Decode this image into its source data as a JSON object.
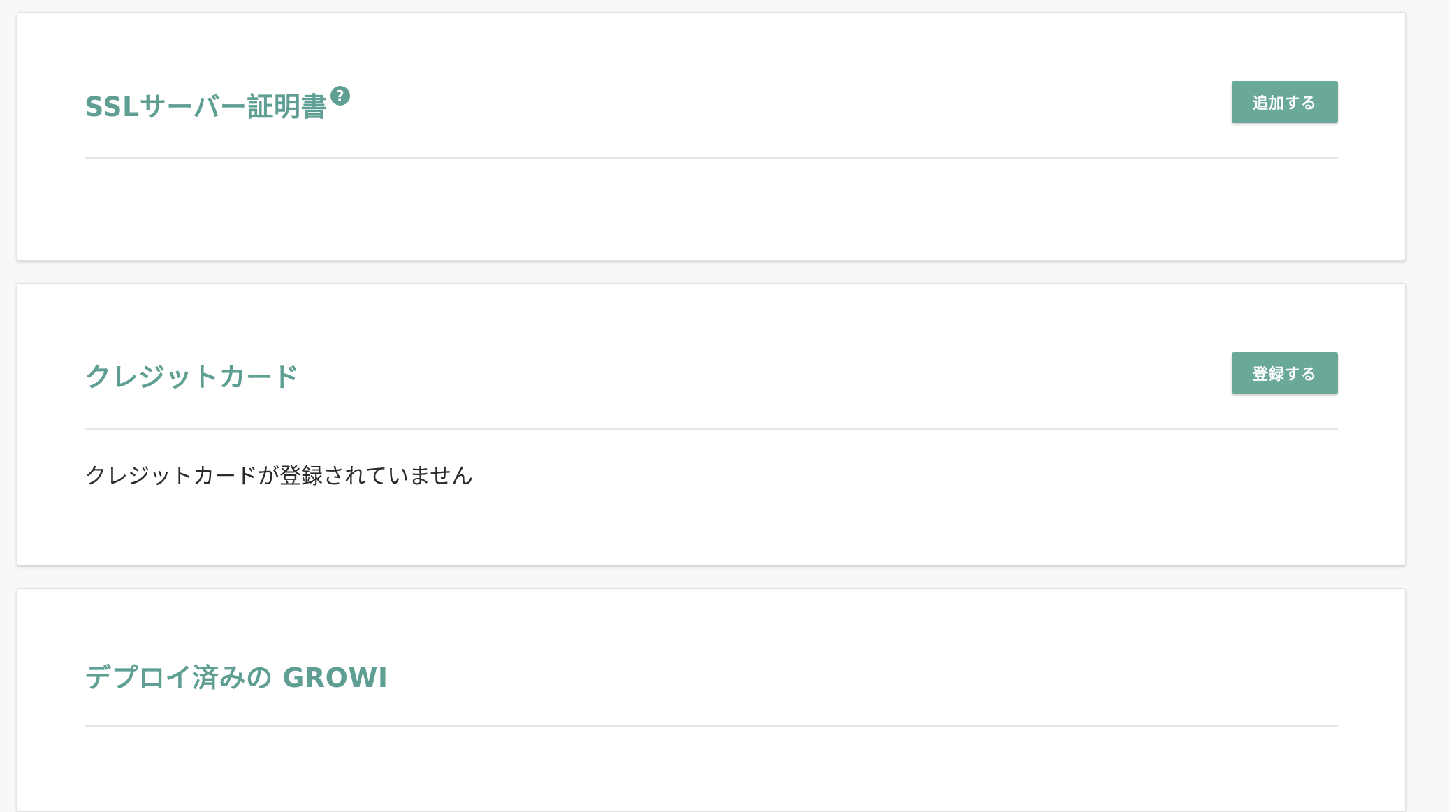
{
  "ssl_section": {
    "title": "SSLサーバー証明書",
    "help_icon": "question-circle-icon",
    "add_button_label": "追加する"
  },
  "credit_card_section": {
    "title": "クレジットカード",
    "register_button_label": "登録する",
    "empty_message": "クレジットカードが登録されていません"
  },
  "deployed_section": {
    "title": "デプロイ済みの GROWI"
  },
  "colors": {
    "accent": "#5f9e92",
    "button_bg": "#6aa89a",
    "divider": "#e6e6e6"
  }
}
